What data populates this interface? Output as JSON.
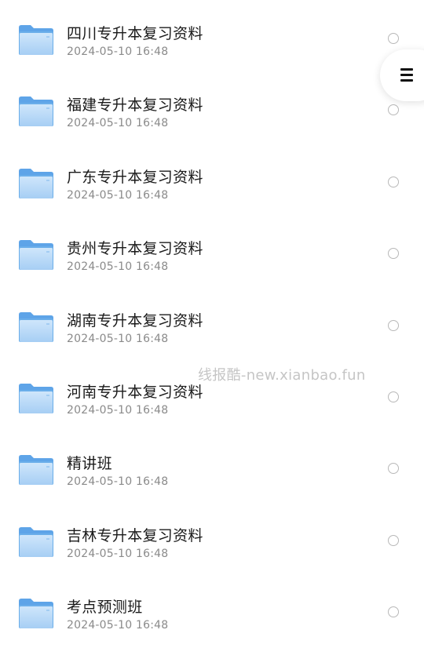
{
  "files": [
    {
      "name": "四川专升本复习资料",
      "date": "2024-05-10 16:48",
      "icon": "folder-icon",
      "selected": false
    },
    {
      "name": "福建专升本复习资料",
      "date": "2024-05-10 16:48",
      "icon": "folder-icon",
      "selected": false
    },
    {
      "name": "广东专升本复习资料",
      "date": "2024-05-10 16:48",
      "icon": "folder-icon",
      "selected": false
    },
    {
      "name": "贵州专升本复习资料",
      "date": "2024-05-10 16:48",
      "icon": "folder-icon",
      "selected": false
    },
    {
      "name": "湖南专升本复习资料",
      "date": "2024-05-10 16:48",
      "icon": "folder-icon",
      "selected": false
    },
    {
      "name": "河南专升本复习资料",
      "date": "2024-05-10 16:48",
      "icon": "folder-icon",
      "selected": false
    },
    {
      "name": "精讲班",
      "date": "2024-05-10 16:48",
      "icon": "folder-icon",
      "selected": false
    },
    {
      "name": "吉林专升本复习资料",
      "date": "2024-05-10 16:48",
      "icon": "folder-icon",
      "selected": false
    },
    {
      "name": "考点预测班",
      "date": "2024-05-10 16:48",
      "icon": "folder-icon",
      "selected": false
    }
  ],
  "watermark": "线报酷-new.xianbao.fun",
  "menu_button": {
    "icon": "menu-icon"
  },
  "colors": {
    "folder": "#5ea4e8",
    "folder_light": "#a9d0f5",
    "text": "#1a1a1a",
    "date": "#8a8a8a"
  }
}
